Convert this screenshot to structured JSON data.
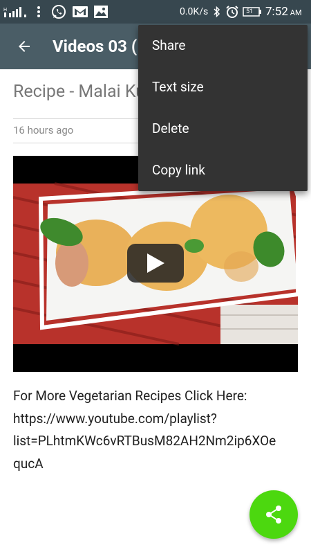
{
  "status_bar": {
    "speed": "0.0K/s",
    "battery": "51",
    "time": "7:52",
    "ampm": "AM",
    "icons": [
      "signal-icon",
      "more-dots-icon",
      "whatsapp-icon",
      "gmail-icon",
      "gallery-icon",
      "bluetooth-icon",
      "alarm-icon",
      "battery-icon"
    ]
  },
  "toolbar": {
    "title": "Videos 03 (",
    "back_icon": "arrow-back-icon"
  },
  "post": {
    "title": "Recipe - Malai Ku",
    "timestamp": "16 hours ago",
    "video_play_icon": "play-icon",
    "description_lines": [
      "For More Vegetarian Recipes Click Here:",
      "https://www.youtube.com/playlist?",
      "list=PLhtmKWc6vRTBusM82AH2Nm2ip6XOe",
      "qucA"
    ]
  },
  "menu": {
    "items": [
      "Share",
      "Text size",
      "Delete",
      "Copy link"
    ]
  },
  "fab": {
    "icon": "share-icon",
    "color": "#4cd80f"
  },
  "colors": {
    "toolbar": "#4a5d66",
    "status_bar": "#37474f",
    "menu_bg": "#333333"
  }
}
